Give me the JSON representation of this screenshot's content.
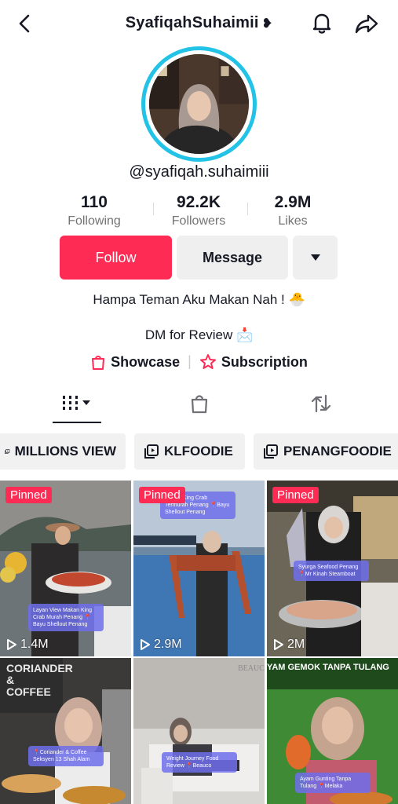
{
  "header": {
    "username": "SyafiqahSuhaimii",
    "heart_glyph": "❥",
    "back_icon": "chevron-left-icon",
    "bell_icon": "bell-icon",
    "share_icon": "share-arrow-icon"
  },
  "profile": {
    "handle": "@syafiqah.suhaimiii",
    "ring_color": "#22c3e6"
  },
  "stats": [
    {
      "value": "110",
      "label": "Following"
    },
    {
      "value": "92.2K",
      "label": "Followers"
    },
    {
      "value": "2.9M",
      "label": "Likes"
    }
  ],
  "buttons": {
    "follow": "Follow",
    "message": "Message",
    "follow_color": "#fe2c55"
  },
  "bio": {
    "line1": "Hampa Teman Aku Makan Nah ! 🐣",
    "line2": "DM for Review 📩"
  },
  "links": {
    "showcase": "Showcase",
    "subscription": "Subscription"
  },
  "tabs": [
    "videos-grid-icon",
    "shopping-bag-icon",
    "repost-icon"
  ],
  "playlists": [
    "MILLIONS VIEW",
    "KLFOODIE",
    "PENANGFOODIE"
  ],
  "videos": [
    {
      "pinned": "Pinned",
      "views": "1.4M",
      "caption": "Layan View Makan King Crab Murah Penang 📍Bayu Shellout Penang"
    },
    {
      "pinned": "Pinned",
      "views": "2.9M",
      "caption": "Makan King Crab Termurah Penang 📍Bayu Shellout Penang"
    },
    {
      "pinned": "Pinned",
      "views": "2M",
      "caption": "Syurga Seafood Penang 📍Mr Kinah Steamboat"
    },
    {
      "pinned": "",
      "views": "",
      "caption": "📍Coriander & Coffee Seksyen 13 Shah Alam"
    },
    {
      "pinned": "",
      "views": "",
      "caption": "Weight Journey Food Review 📍Beauco"
    },
    {
      "pinned": "",
      "views": "",
      "caption": "Ayam Gunting Tanpa Tulang 📍Melaka"
    }
  ],
  "storefront_texts": [
    "CORIANDER & COFFEE",
    "BEAUC",
    "YAM GEMOK TANPA TULANG"
  ]
}
